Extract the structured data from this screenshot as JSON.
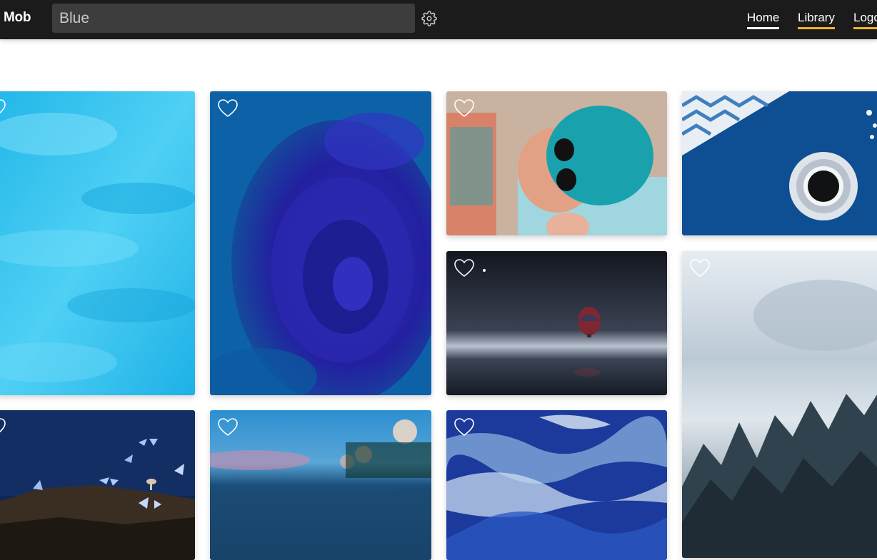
{
  "app": {
    "brand": "Mob"
  },
  "search": {
    "value": "Blue"
  },
  "nav": {
    "items": [
      {
        "label": "Home",
        "underline": "#ffffff"
      },
      {
        "label": "Library",
        "underline": "#f0b429"
      },
      {
        "label": "Logout",
        "underline": "#f0b429"
      }
    ]
  },
  "gallery": {
    "images": [
      {
        "subject": "turquoise water",
        "favorited": false
      },
      {
        "subject": "blue rose with water drops",
        "favorited": false
      },
      {
        "subject": "woman with teal hair and sunglasses",
        "favorited": false
      },
      {
        "subject": "coffee cup on blue cloth",
        "favorited": false
      },
      {
        "subject": "hot air balloon over sea at night",
        "favorited": false
      },
      {
        "subject": "misty blue forest",
        "favorited": false
      },
      {
        "subject": "butterflies and mushrooms at night",
        "favorited": false
      },
      {
        "subject": "blurred road at dusk",
        "favorited": false
      },
      {
        "subject": "ocean waves",
        "favorited": false
      }
    ]
  },
  "colors": {
    "topbar": "#1b1b1b",
    "search_bg": "#3d3d3d",
    "accent": "#f0b429"
  },
  "icons": {
    "settings": "gear-icon",
    "favorite": "heart-icon"
  }
}
